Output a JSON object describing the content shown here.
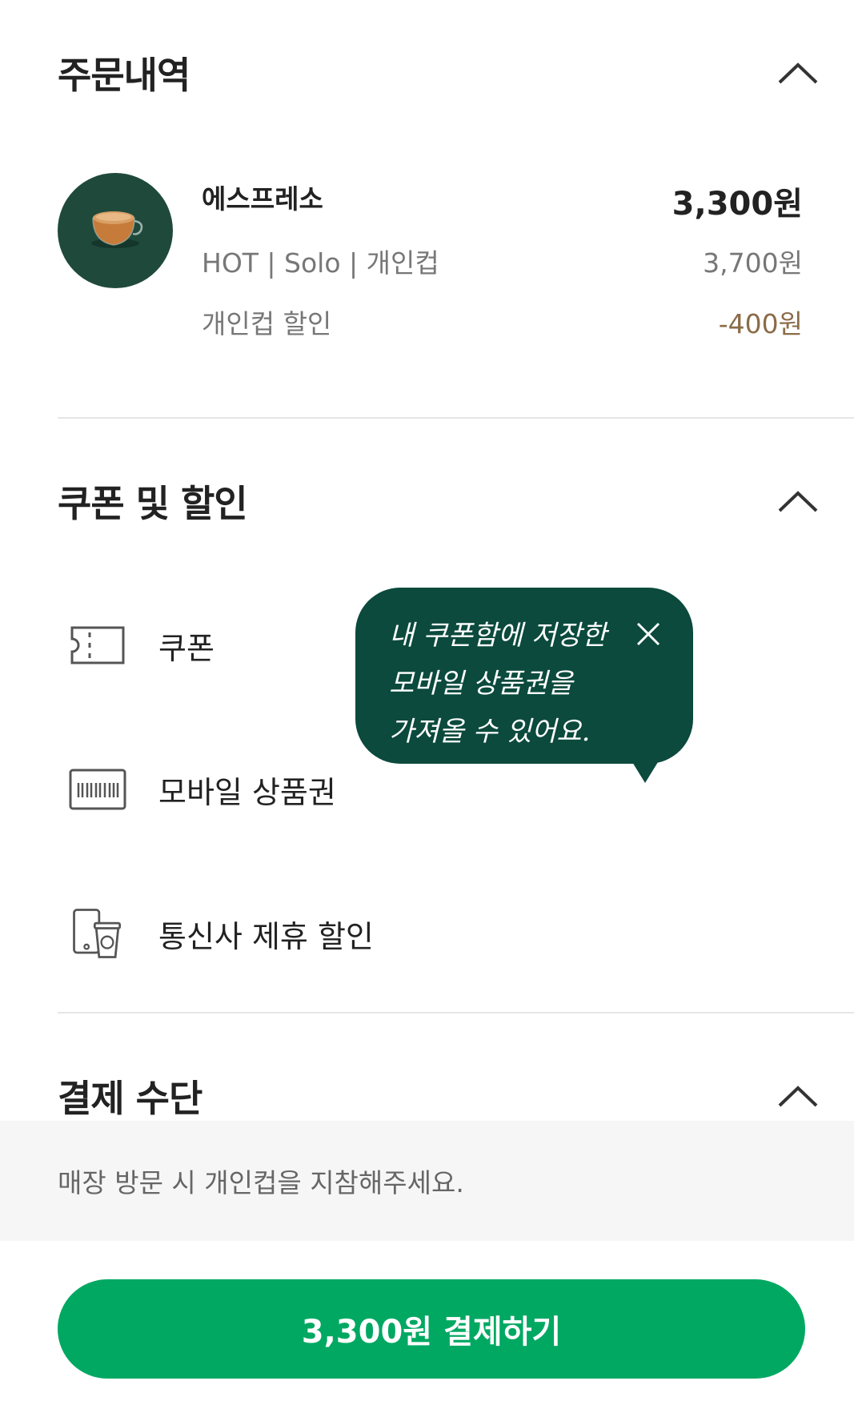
{
  "order_section": {
    "title": "주문내역",
    "item": {
      "name": "에스프레소",
      "price": "3,300원",
      "options": "HOT | Solo | 개인컵",
      "original_price": "3,700원",
      "discount_label": "개인컵 할인",
      "discount_value": "-400원"
    }
  },
  "coupon_section": {
    "title": "쿠폰 및 할인",
    "options": [
      {
        "label": "쿠폰",
        "icon": "ticket-icon"
      },
      {
        "label": "모바일 상품권",
        "icon": "gift-card-barcode-icon"
      },
      {
        "label": "통신사 제휴 할인",
        "icon": "phone-cup-icon"
      }
    ],
    "tooltip": {
      "lines": [
        "내 쿠폰함에 저장한",
        "모바일 상품권을",
        "가져올 수 있어요."
      ]
    }
  },
  "payment_section": {
    "title": "결제 수단"
  },
  "notice": "매장 방문 시 개인컵을 지참해주세요.",
  "pay_button": "3,300원 결제하기",
  "colors": {
    "primary_green": "#00a862",
    "tooltip_green": "#0b4a3d",
    "discount_brown": "#8b6b48"
  }
}
